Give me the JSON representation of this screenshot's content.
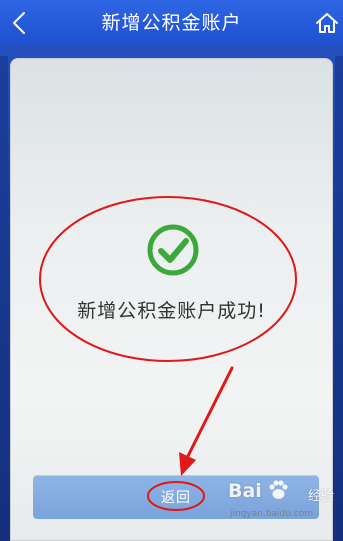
{
  "header": {
    "title": "新增公积金账户",
    "back_icon": "chevron-left-icon",
    "home_icon": "home-icon"
  },
  "result": {
    "icon": "check-circle-icon",
    "message": "新增公积金账户成功!"
  },
  "actions": {
    "return_label": "返回"
  },
  "watermark": {
    "brand": "Bai",
    "suffix": "经验",
    "url": "jingyan.baidu.com"
  },
  "colors": {
    "header_bg": "#2f66e3",
    "success_green": "#3ca83c",
    "annotation_red": "#e01818",
    "button_bg": "#85ade0"
  }
}
